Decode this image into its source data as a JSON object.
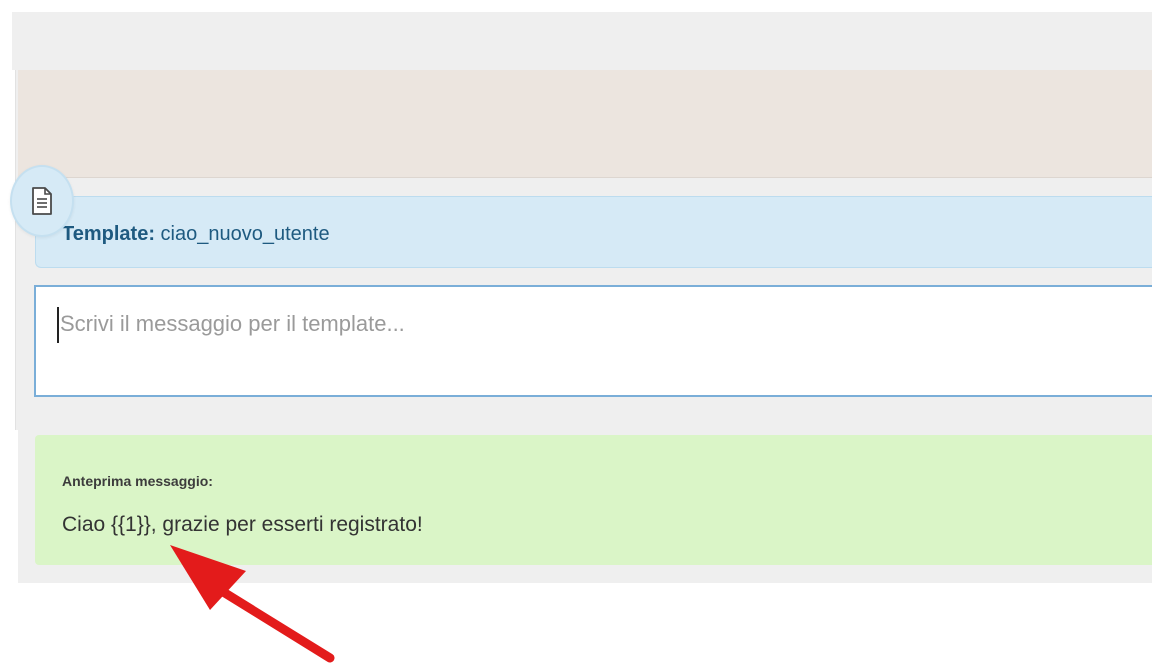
{
  "template": {
    "label": "Template:",
    "name": "ciao_nuovo_utente",
    "icon": "document-icon"
  },
  "message_input": {
    "placeholder": "Scrivi il messaggio per il template...",
    "value": ""
  },
  "preview": {
    "label": "Anteprima messaggio:",
    "text": "Ciao {{1}}, grazie per esserti registrato!"
  },
  "annotation": {
    "icon": "red-arrow-icon",
    "color": "#e31b1b"
  },
  "colors": {
    "template_bar": "#d6eaf6",
    "template_text": "#1e5a80",
    "input_border": "#7aaed8",
    "preview_bg": "#daf5c7",
    "beige_strip": "#ece5df"
  }
}
